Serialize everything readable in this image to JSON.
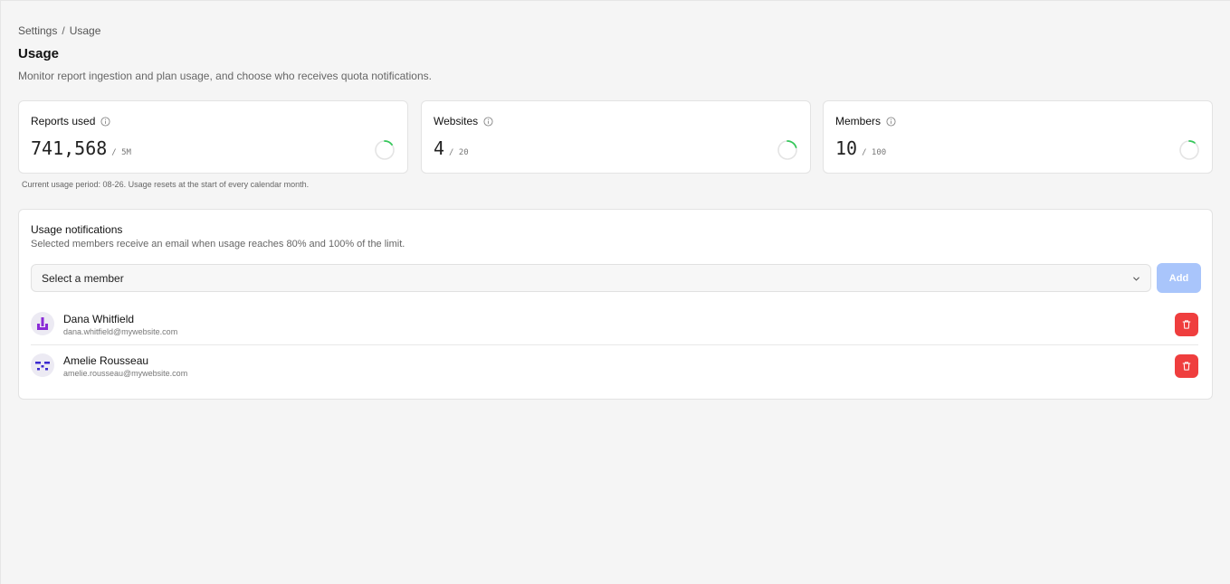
{
  "breadcrumb": {
    "parent": "Settings",
    "separator": "/",
    "current": "Usage"
  },
  "header": {
    "title": "Usage",
    "description": "Monitor report ingestion and plan usage, and choose who receives quota notifications."
  },
  "stats": [
    {
      "label": "Reports used",
      "value": "741,568",
      "limit": "/ 5M",
      "ratio": 0.148
    },
    {
      "label": "Websites",
      "value": "4",
      "limit": "/ 20",
      "ratio": 0.2
    },
    {
      "label": "Members",
      "value": "10",
      "limit": "/ 100",
      "ratio": 0.1
    }
  ],
  "period_note": "Current usage period: 08-26. Usage resets at the start of every calendar month.",
  "notifications": {
    "title": "Usage notifications",
    "description": "Selected members receive an email when usage reaches 80% and 100% of the limit.",
    "select_placeholder": "Select a member",
    "add_label": "Add",
    "members": [
      {
        "name": "Dana Whitfield",
        "email": "dana.whitfield@mywebsite.com"
      },
      {
        "name": "Amelie Rousseau",
        "email": "amelie.rousseau@mywebsite.com"
      }
    ]
  },
  "colors": {
    "ring_progress": "#34c759",
    "ring_track": "#e4e4e4",
    "add_button": "#a9c5fb",
    "delete_button": "#ef3e3e",
    "avatar_1": "#8a2bd6",
    "avatar_2": "#3b2ad0"
  },
  "icons": {
    "info": "info-circle-icon",
    "chevron": "chevron-down-icon",
    "delete": "trash-icon"
  }
}
